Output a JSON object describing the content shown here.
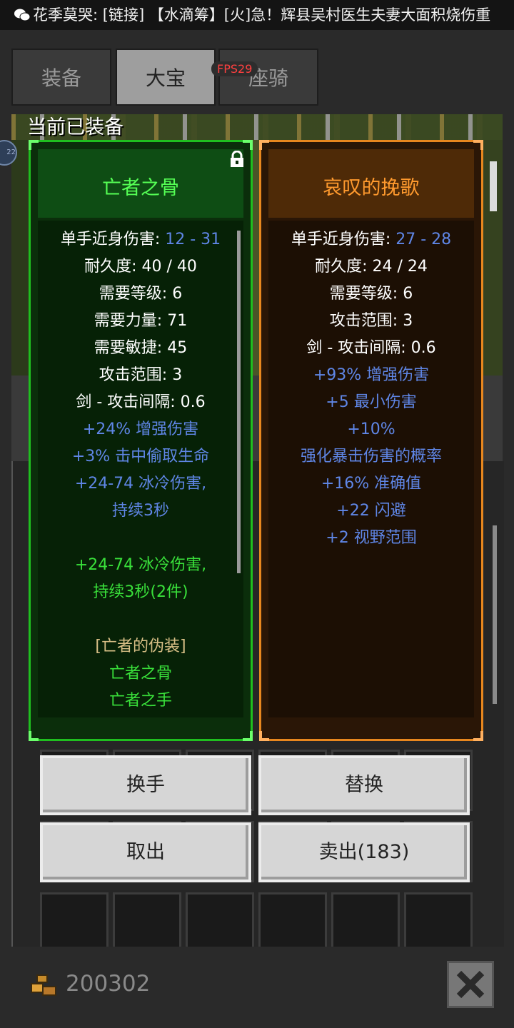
{
  "notification": {
    "icon": "wechat-icon",
    "text": "花季莫哭: [链接] 【水滴筹】[火]急！辉县吴村医生夫妻大面积烧伤重"
  },
  "tabs": [
    {
      "label": "装备",
      "active": false
    },
    {
      "label": "大宝",
      "active": true
    },
    {
      "label": "座骑",
      "active": false
    }
  ],
  "fps_label": "FPS29",
  "avatar_badge": "22",
  "section_title": "当前已装备",
  "equipped_item": {
    "name": "亡者之骨",
    "locked": true,
    "stats": [
      {
        "label": "单手近身伤害: ",
        "value": "12 - 31"
      },
      {
        "label": "耐久度: 40 / 40"
      },
      {
        "label": "需要等级: 6"
      },
      {
        "label": "需要力量: 71"
      },
      {
        "label": "需要敏捷: 45"
      },
      {
        "label": "攻击范围: 3"
      },
      {
        "label": "剑 - 攻击间隔: 0.6"
      }
    ],
    "magic_lines": [
      "+24% 增强伤害",
      "+3% 击中偷取生命",
      "+24-74 冰冷伤害,",
      "持续3秒"
    ],
    "set_bonus_lines": [
      "+24-74 冰冷伤害,",
      "持续3秒(2件)"
    ],
    "set_name": "[亡者的伪装]",
    "set_items": [
      "亡者之骨",
      "亡者之手"
    ]
  },
  "compare_item": {
    "name": "哀叹的挽歌",
    "stats": [
      {
        "label": "单手近身伤害: ",
        "value": "27 - 28"
      },
      {
        "label": "耐久度: 24 / 24"
      },
      {
        "label": "需要等级: 6"
      },
      {
        "label": "攻击范围: 3"
      },
      {
        "label": "剑 - 攻击间隔: 0.6"
      }
    ],
    "magic_lines": [
      "+93% 增强伤害",
      "+5 最小伤害",
      "+10%",
      "强化暴击伤害的概率",
      "+16% 准确值",
      "+22 闪避",
      "+2 视野范围"
    ]
  },
  "buttons": {
    "swap_hand": "换手",
    "replace": "替换",
    "take_out": "取出",
    "sell": "卖出(183)"
  },
  "currency": {
    "icon": "gold-coins-icon",
    "amount": "200302"
  },
  "close_icon": "close-icon",
  "colors": {
    "set_green": "#1fbf1f",
    "unique_orange": "#e8871e",
    "magic_blue": "#5f86e6",
    "set_text_green": "#39e03a",
    "set_name_gold": "#d8bf86"
  }
}
